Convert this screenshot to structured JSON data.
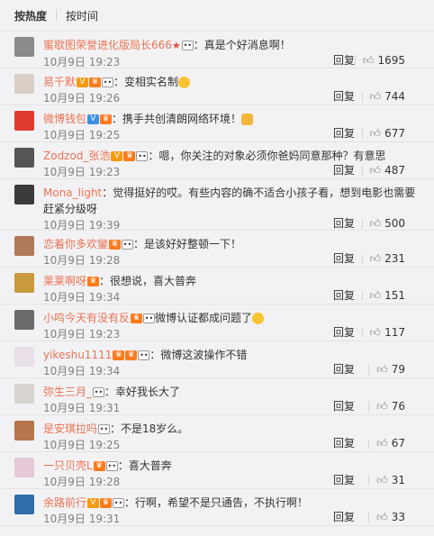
{
  "sort": {
    "hot_label": "按热度",
    "time_label": "按时间"
  },
  "comments": [
    {
      "user": "蜜歇图荣誉进化版局长666",
      "text": "：真是个好消息啊！",
      "time": "10月9日 19:23",
      "reply": "回复",
      "likes": "1695",
      "badges": [
        "star",
        "panda"
      ],
      "avatar_color": "#8a8a8a"
    },
    {
      "user": "易千默",
      "text": "：变相实名制",
      "time": "10月9日 19:26",
      "reply": "回复",
      "likes": "744",
      "badges": [
        "v",
        "crown",
        "panda"
      ],
      "emoji": "smile",
      "avatar_color": "#d9cfc6"
    },
    {
      "user": "微博钱包",
      "text": "：携手共创清朗网络环境！",
      "time": "10月9日 19:25",
      "reply": "回复",
      "likes": "677",
      "badges": [
        "vb",
        "crown"
      ],
      "emoji": "hand",
      "avatar_color": "#e03a2f"
    },
    {
      "user": "Zodzod_张浩",
      "text": "：嗯，你关注的对象必须你爸妈同意那种？有意思",
      "time": "10月9日 19:23",
      "reply": "回复",
      "likes": "487",
      "badges": [
        "v",
        "crown",
        "panda"
      ],
      "avatar_color": "#555555"
    },
    {
      "user": "Mona_light",
      "text": "：觉得挺好的哎。有些内容的确不适合小孩子看，想到电影也需要赶紧分级呀",
      "time": "10月9日 19:39",
      "reply": "回复",
      "likes": "500",
      "badges": [],
      "avatar_color": "#3a3a3a"
    },
    {
      "user": "恋着你多欢鑾",
      "text": "：是该好好整顿一下！",
      "time": "10月9日 19:28",
      "reply": "回复",
      "likes": "231",
      "badges": [
        "crown",
        "panda"
      ],
      "avatar_color": "#b07a5a"
    },
    {
      "user": "莱莱啊呀",
      "text": "：很想说，喜大普奔",
      "time": "10月9日 19:34",
      "reply": "回复",
      "likes": "151",
      "badges": [
        "crown"
      ],
      "avatar_color": "#c99a3b"
    },
    {
      "user": "小鸣今天有没有反",
      "text": "微博认证都成问题了",
      "time": "10月9日 19:23",
      "reply": "回复",
      "likes": "117",
      "badges": [
        "crown",
        "panda"
      ],
      "emoji": "smile",
      "avatar_color": "#6b6b6b"
    },
    {
      "user": "yikeshu1111",
      "text": "：微博这波操作不错",
      "time": "10月9日 19:34",
      "reply": "回复",
      "likes": "79",
      "badges": [
        "crown",
        "crown",
        "panda"
      ],
      "avatar_color": "#e8e0e6"
    },
    {
      "user": "弥生三月_",
      "text": "：幸好我长大了",
      "time": "10月9日 19:31",
      "reply": "回复",
      "likes": "76",
      "badges": [
        "panda"
      ],
      "avatar_color": "#d8d4d0"
    },
    {
      "user": "是安琪拉吗",
      "text": "：不是18岁么。",
      "time": "10月9日 19:25",
      "reply": "回复",
      "likes": "67",
      "badges": [
        "panda"
      ],
      "avatar_color": "#b6754a"
    },
    {
      "user": "一只贝壳L",
      "text": "：喜大普奔",
      "time": "10月9日 19:28",
      "reply": "回复",
      "likes": "31",
      "badges": [
        "crown",
        "panda"
      ],
      "avatar_color": "#e6c9d6"
    },
    {
      "user": "余路前行",
      "text": "：行啊，希望不是只通告，不执行啊！",
      "time": "10月9日 19:31",
      "reply": "回复",
      "likes": "33",
      "badges": [
        "v",
        "crown",
        "panda"
      ],
      "avatar_color": "#2f6ea8"
    }
  ]
}
